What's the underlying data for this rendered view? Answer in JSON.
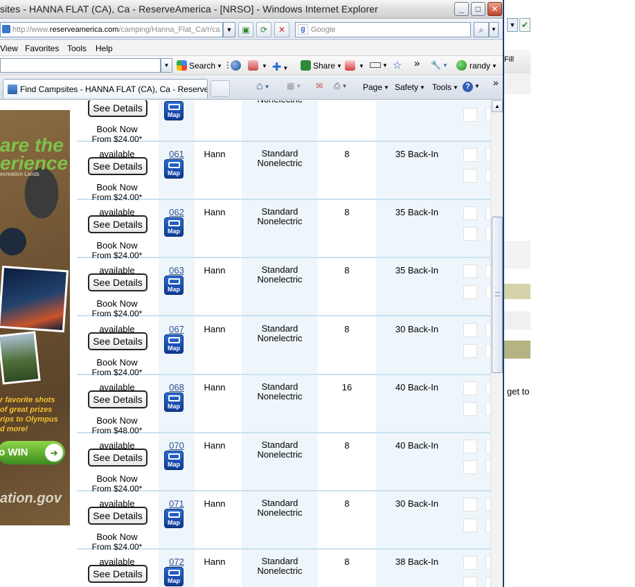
{
  "window": {
    "title": "sites - HANNA FLAT (CA), Ca - ReserveAmerica - [NRSO] - Windows Internet Explorer",
    "minimize": "_",
    "maximize": "□",
    "close": "✕"
  },
  "address_bar": {
    "url_prefix": "http://www.",
    "url_host": "reserveamerica.com",
    "url_path": "/camping/Hanna_Flat_Ca/r/ca",
    "search_placeholder": "Google"
  },
  "menu": [
    "View",
    "Favorites",
    "Tools",
    "Help"
  ],
  "toolbar": {
    "search_label": "Search",
    "share_label": "Share",
    "user_label": "randy",
    "more": "»"
  },
  "tab": {
    "label": "Find Campsites - HANNA FLAT (CA), Ca - ReserveAm..."
  },
  "command_bar": {
    "page": "Page",
    "safety": "Safety",
    "tools": "Tools",
    "more": "»"
  },
  "ad": {
    "logo_text": "are the\nerience",
    "tagline": "ecreation Lands",
    "photo_credit": "ional Park",
    "promo": "r favorite shots\nof great prizes\nrips to Olympus\nd more!",
    "win_label": "o WIN",
    "site": "ation.gov"
  },
  "background_window": {
    "fill_label": "Fill",
    "text": "get to"
  },
  "table": {
    "see_details_label": "See Details",
    "map_label": "Map",
    "book_now_label": "Book Now",
    "top_partial": {
      "type": "Nonelectric",
      "book_now": "Book Now",
      "price": "From $24.00*"
    },
    "rows": [
      {
        "status": "available",
        "site": "061",
        "loop": "Hann",
        "type_line1": "Standard",
        "type_line2": "Nonelectric",
        "occupants": "8",
        "equipment": "35 Back-In",
        "price": "From $24.00*"
      },
      {
        "status": "available",
        "site": "062",
        "loop": "Hann",
        "type_line1": "Standard",
        "type_line2": "Nonelectric",
        "occupants": "8",
        "equipment": "35 Back-In",
        "price": "From $24.00*"
      },
      {
        "status": "available",
        "site": "063",
        "loop": "Hann",
        "type_line1": "Standard",
        "type_line2": "Nonelectric",
        "occupants": "8",
        "equipment": "35 Back-In",
        "price": "From $24.00*"
      },
      {
        "status": "available",
        "site": "067",
        "loop": "Hann",
        "type_line1": "Standard",
        "type_line2": "Nonelectric",
        "occupants": "8",
        "equipment": "30 Back-In",
        "price": "From $24.00*"
      },
      {
        "status": "available",
        "site": "068",
        "loop": "Hann",
        "type_line1": "Standard",
        "type_line2": "Nonelectric",
        "occupants": "16",
        "equipment": "40 Back-In",
        "price": "From $48.00*"
      },
      {
        "status": "available",
        "site": "070",
        "loop": "Hann",
        "type_line1": "Standard",
        "type_line2": "Nonelectric",
        "occupants": "8",
        "equipment": "40 Back-In",
        "price": "From $24.00*"
      },
      {
        "status": "available",
        "site": "071",
        "loop": "Hann",
        "type_line1": "Standard",
        "type_line2": "Nonelectric",
        "occupants": "8",
        "equipment": "30 Back-In",
        "price": "From $24.00*"
      },
      {
        "status": "available",
        "site": "072",
        "loop": "Hann",
        "type_line1": "Standard",
        "type_line2": "Nonelectric",
        "occupants": "8",
        "equipment": "38 Back-In",
        "price": ""
      }
    ]
  }
}
